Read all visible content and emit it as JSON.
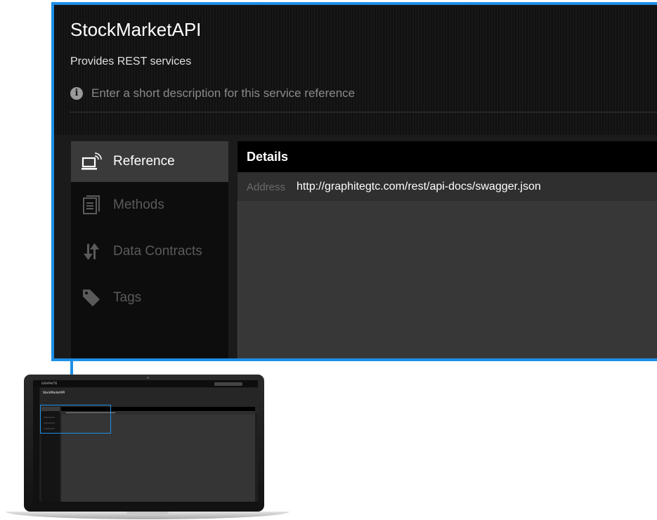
{
  "service": {
    "title": "StockMarketAPI",
    "subtitle": "Provides REST services",
    "description_placeholder": "Enter a short description for this service reference"
  },
  "nav": {
    "items": [
      {
        "label": "Reference",
        "icon": "reference-icon",
        "active": true
      },
      {
        "label": "Methods",
        "icon": "methods-icon",
        "active": false
      },
      {
        "label": "Data Contracts",
        "icon": "data-contracts-icon",
        "active": false
      },
      {
        "label": "Tags",
        "icon": "tag-icon",
        "active": false
      }
    ]
  },
  "details": {
    "title": "Details",
    "address_label": "Address",
    "address_value": "http://graphitegtc.com/rest/api-docs/swagger.json"
  },
  "laptop_screen": {
    "brand": "GRAPHITE",
    "title": "StockMarketAPI"
  },
  "colors": {
    "accent": "#1e8fe6",
    "background": "#1b1b1b",
    "active_nav": "#3a3a3a"
  }
}
